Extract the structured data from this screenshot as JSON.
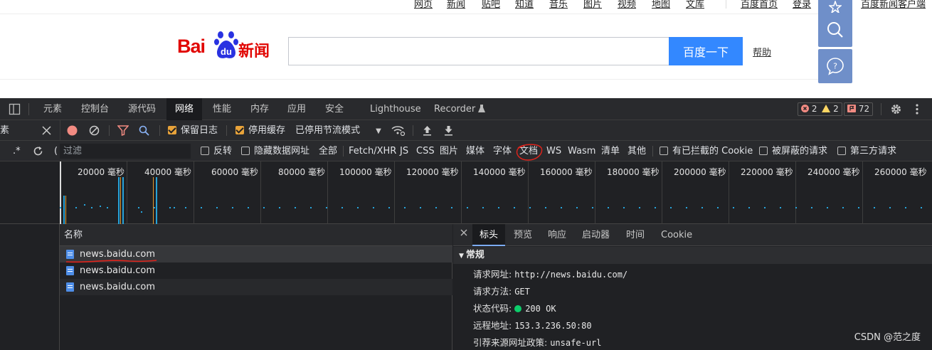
{
  "topnav": {
    "links": [
      "网页",
      "新闻",
      "贴吧",
      "知道",
      "音乐",
      "图片",
      "视频",
      "地图",
      "文库"
    ],
    "right_links": [
      "百度首页",
      "登录"
    ],
    "client_link": "百度新闻客户端"
  },
  "logo": {
    "text_bai": "Bai",
    "text_du": "du",
    "text_news": "新闻"
  },
  "search": {
    "value": "",
    "button_label": "百度一下",
    "help_label": "帮助"
  },
  "devtools": {
    "tabs": [
      "元素",
      "控制台",
      "源代码",
      "网络",
      "性能",
      "内存",
      "应用",
      "安全",
      "Lighthouse",
      "Recorder"
    ],
    "active_tab": "网络",
    "badges": {
      "errors": "2",
      "warnings": "2",
      "issues": "72"
    },
    "toolbar1": {
      "left_fragment": "素",
      "preserve_log": "保留日志",
      "disable_cache": "停用缓存",
      "throttle": "已停用节流模式"
    },
    "toolbar2": {
      "regex_label": ".*",
      "filter_placeholder": "过滤",
      "invert": "反转",
      "hide_data_urls": "隐藏数据网址",
      "types": [
        "全部",
        "Fetch/XHR",
        "JS",
        "CSS",
        "图片",
        "媒体",
        "字体",
        "文档",
        "WS",
        "Wasm",
        "清单",
        "其他"
      ],
      "blocked_cookies": "有已拦截的 Cookie",
      "blocked_requests": "被屏蔽的请求",
      "third_party": "第三方请求"
    },
    "timeline_ticks": [
      "20000 毫秒",
      "40000 毫秒",
      "60000 毫秒",
      "80000 毫秒",
      "100000 毫秒",
      "120000 毫秒",
      "140000 毫秒",
      "160000 毫秒",
      "180000 毫秒",
      "200000 毫秒",
      "220000 毫秒",
      "240000 毫秒",
      "260000 毫秒"
    ],
    "requests": {
      "header": "名称",
      "rows": [
        "news.baidu.com",
        "news.baidu.com",
        "news.baidu.com"
      ]
    },
    "detail": {
      "tabs": [
        "标头",
        "预览",
        "响应",
        "启动器",
        "时间",
        "Cookie"
      ],
      "active_tab": "标头",
      "section": "常规",
      "fields": [
        {
          "key": "请求网址:",
          "value": "http://news.baidu.com/"
        },
        {
          "key": "请求方法:",
          "value": "GET"
        },
        {
          "key": "状态代码:",
          "value": "200 OK"
        },
        {
          "key": "远程地址:",
          "value": "153.3.236.50:80"
        },
        {
          "key": "引荐来源网址政策:",
          "value": "unsafe-url"
        }
      ]
    }
  },
  "watermark": "CSDN @范之度",
  "colors": {
    "baidu_red": "#e10602",
    "search_blue": "#3388ff",
    "devtools_bg": "#202124",
    "status_green": "#0cce6b",
    "checkbox_orange": "#e8a33a"
  }
}
